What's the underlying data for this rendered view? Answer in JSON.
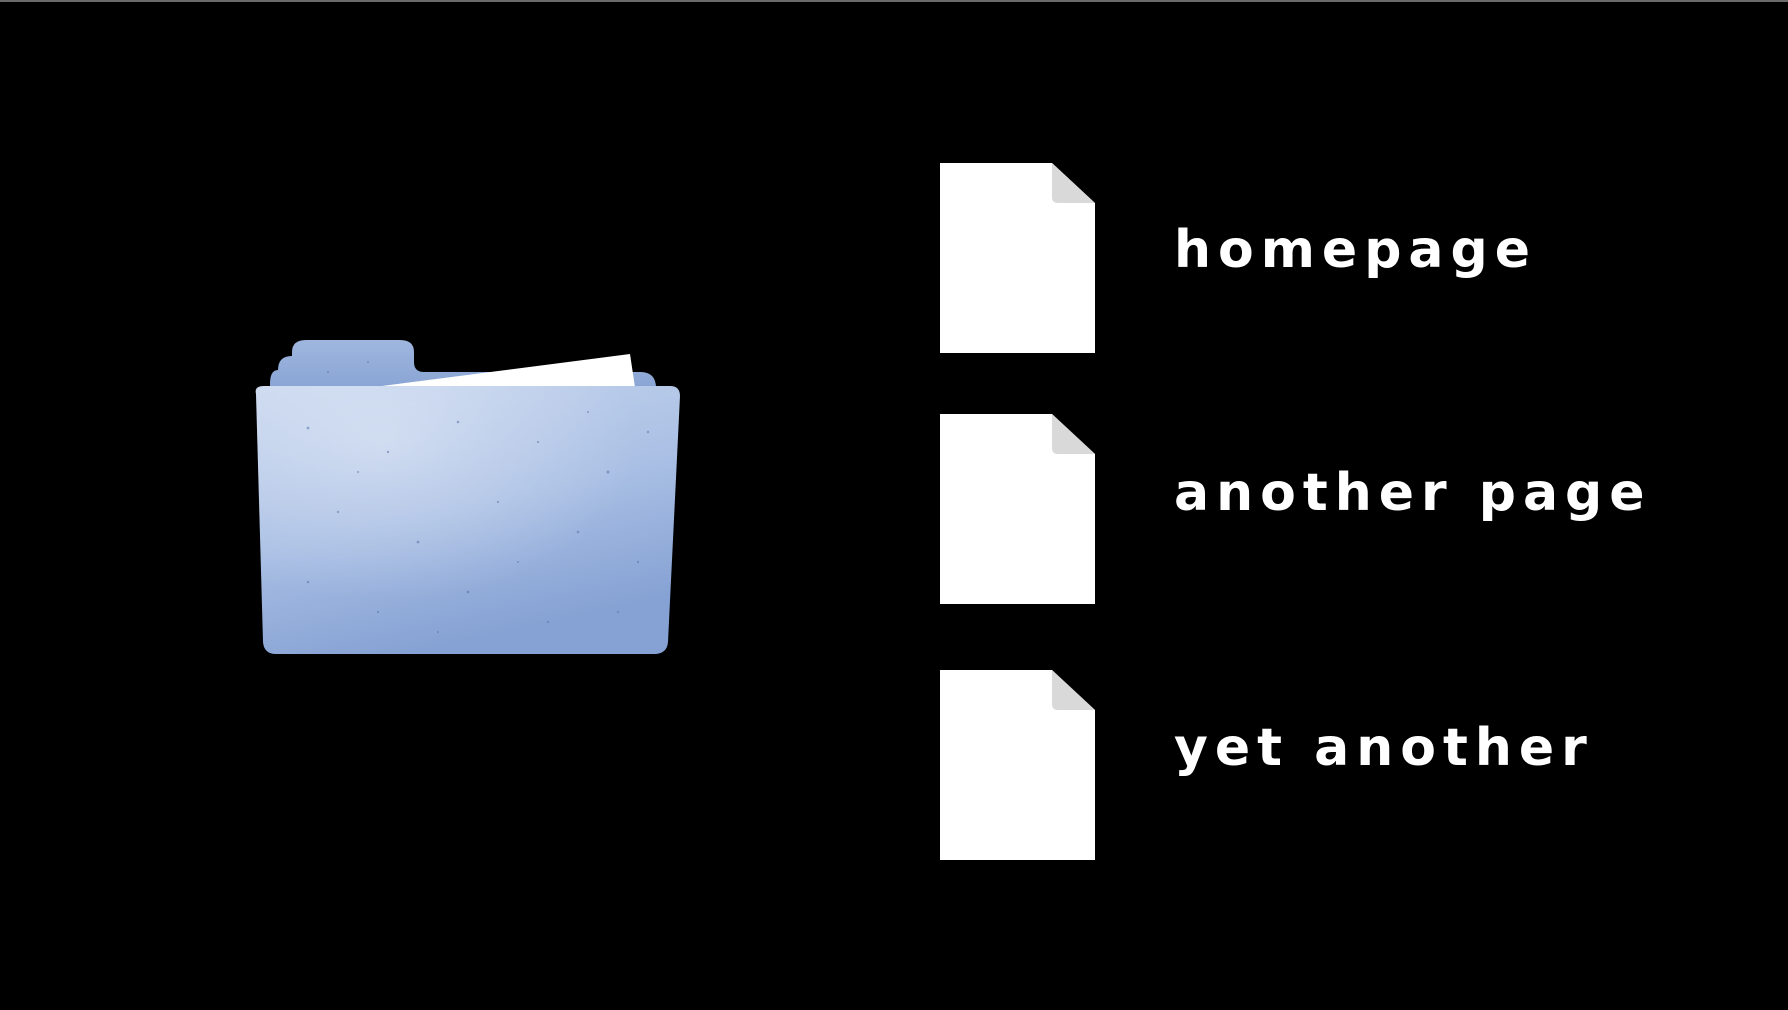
{
  "icons": {
    "folder": "folder-icon",
    "file": "document-icon"
  },
  "colors": {
    "background": "#000000",
    "folder_light": "#b9cbe8",
    "folder_dark": "#8aa5d6",
    "file": "#ffffff",
    "text": "#ffffff"
  },
  "files": [
    {
      "label": "homepage"
    },
    {
      "label": "another page"
    },
    {
      "label": "yet another"
    }
  ]
}
